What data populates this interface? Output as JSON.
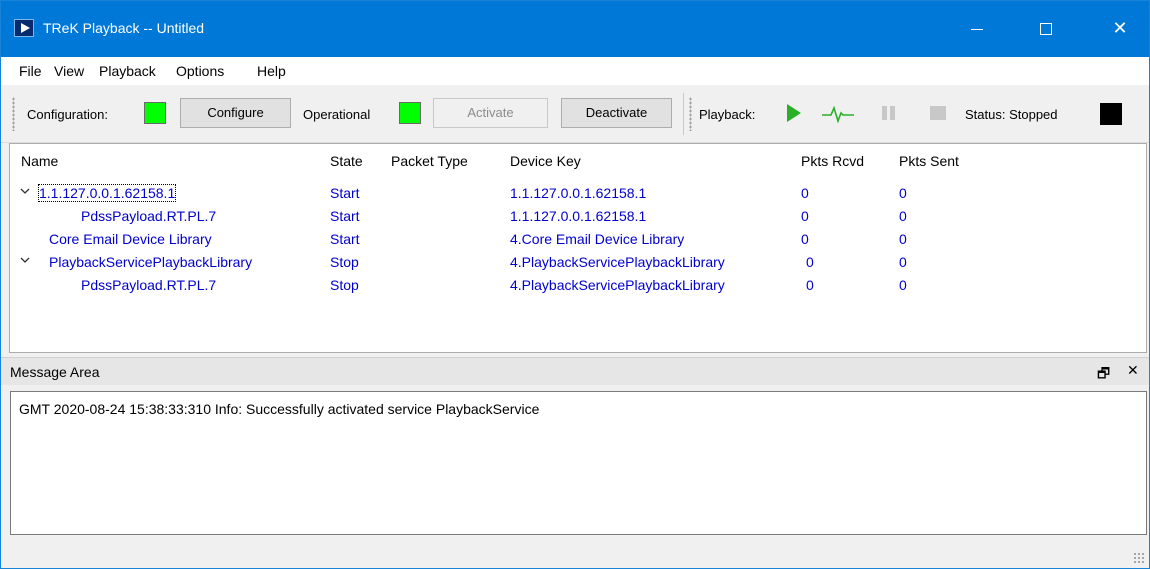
{
  "window": {
    "title": "TReK Playback -- Untitled"
  },
  "menubar": {
    "items": [
      "File",
      "View",
      "Playback",
      "Options",
      "Help"
    ]
  },
  "toolbar": {
    "configuration_label": "Configuration:",
    "configure_label": "Configure",
    "operational_label": "Operational",
    "activate_label": "Activate",
    "deactivate_label": "Deactivate",
    "playback_label": "Playback:",
    "status_label": "Status: Stopped",
    "colors": {
      "led_on": "#00ff00",
      "status_stopped": "#000000"
    },
    "icons": [
      "play-icon",
      "signal-icon",
      "pause-icon",
      "stop-icon"
    ]
  },
  "tree": {
    "columns": [
      "Name",
      "State",
      "Packet Type",
      "Device Key",
      "Pkts Rcvd",
      "Pkts Sent"
    ],
    "rows": [
      {
        "name": "1.1.127.0.0.1.62158.1",
        "state": "Start",
        "packet_type": "",
        "device_key": "1.1.127.0.0.1.62158.1",
        "pkts_rcvd": "0",
        "pkts_sent": "0"
      },
      {
        "name": "PdssPayload.RT.PL.7",
        "state": "Start",
        "packet_type": "",
        "device_key": "1.1.127.0.0.1.62158.1",
        "pkts_rcvd": "0",
        "pkts_sent": "0"
      },
      {
        "name": "Core Email Device Library",
        "state": "Start",
        "packet_type": "",
        "device_key": "4.Core Email Device Library",
        "pkts_rcvd": "0",
        "pkts_sent": "0"
      },
      {
        "name": "PlaybackServicePlaybackLibrary",
        "state": "Stop",
        "packet_type": "",
        "device_key": "4.PlaybackServicePlaybackLibrary",
        "pkts_rcvd": "0",
        "pkts_sent": "0"
      },
      {
        "name": "PdssPayload.RT.PL.7",
        "state": "Stop",
        "packet_type": "",
        "device_key": "4.PlaybackServicePlaybackLibrary",
        "pkts_rcvd": "0",
        "pkts_sent": "0"
      }
    ]
  },
  "message_area": {
    "title": "Message Area",
    "lines": [
      "GMT 2020-08-24 15:38:33:310  Info:  Successfully activated service PlaybackService"
    ]
  }
}
